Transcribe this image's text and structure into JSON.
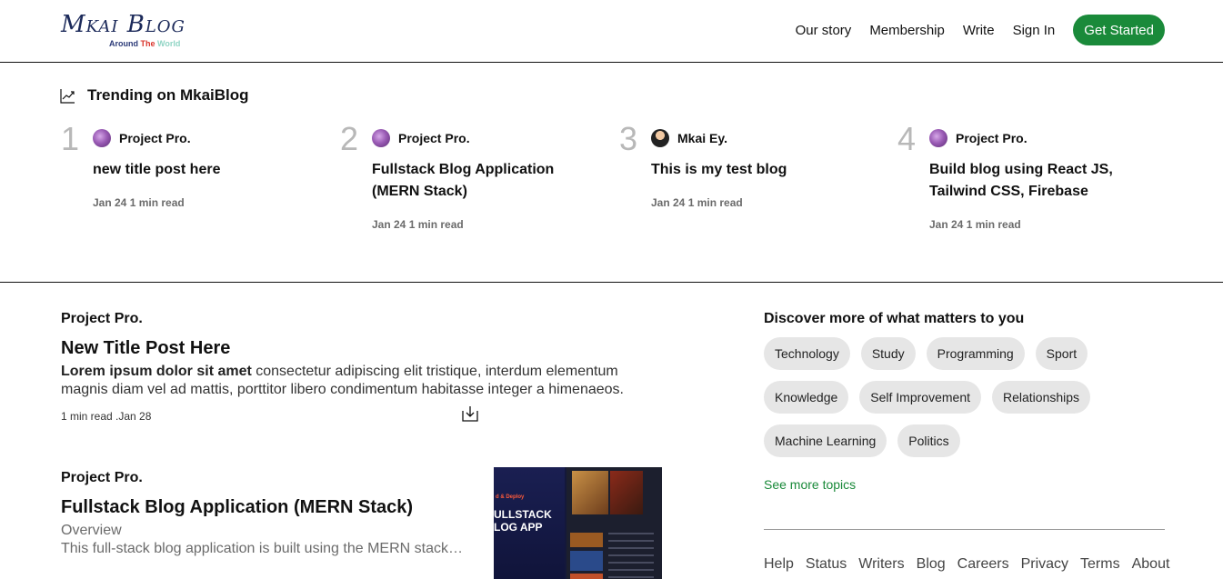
{
  "logo": {
    "main": "Mkai Blog",
    "sub_1": "Around",
    "sub_2": "The",
    "sub_3": "World"
  },
  "nav": {
    "our_story": "Our story",
    "membership": "Membership",
    "write": "Write",
    "sign_in": "Sign In",
    "get_started": "Get Started"
  },
  "trending": {
    "heading": "Trending on MkaiBlog",
    "items": [
      {
        "num": "1",
        "author": "Project Pro.",
        "title": "new title post here",
        "meta": "Jan 24 1 min read"
      },
      {
        "num": "2",
        "author": "Project Pro.",
        "title": "Fullstack Blog Application (MERN Stack)",
        "meta": "Jan 24 1 min read"
      },
      {
        "num": "3",
        "author": "Mkai Ey.",
        "title": "This is my test blog",
        "meta": "Jan 24 1 min read"
      },
      {
        "num": "4",
        "author": "Project Pro.",
        "title": "Build blog using React JS, Tailwind CSS, Firebase",
        "meta": "Jan 24 1 min read"
      }
    ]
  },
  "feed": {
    "posts": [
      {
        "author": "Project Pro.",
        "title": "New Title Post Here",
        "excerpt_bold": "Lorem ipsum dolor sit amet",
        "excerpt": " consectetur adipiscing elit tristique, interdum elementum magnis diam vel ad mattis, porttitor libero condimentum habitasse integer a himenaeos.",
        "meta": "1 min read .Jan 28"
      },
      {
        "author": "Project Pro.",
        "title": "Fullstack Blog Application (MERN Stack)",
        "subtitle": "Overview",
        "excerpt": "This full-stack blog application is built using the MERN stack…",
        "thumb_tag": "d & Deploy",
        "thumb_text": "ULLSTACK\nLOG APP"
      }
    ]
  },
  "sidebar": {
    "title": "Discover more of what matters to you",
    "topics": [
      "Technology",
      "Study",
      "Programming",
      "Sport",
      "Knowledge",
      "Self Improvement",
      "Relationships",
      "Machine Learning",
      "Politics"
    ],
    "see_more": "See more topics"
  },
  "footer": [
    "Help",
    "Status",
    "Writers",
    "Blog",
    "Careers",
    "Privacy",
    "Terms",
    "About"
  ],
  "colors": {
    "brand_green": "#1a8a3a",
    "trend_number": "#b8b8b8",
    "topic_bg": "#e6e6e6"
  }
}
